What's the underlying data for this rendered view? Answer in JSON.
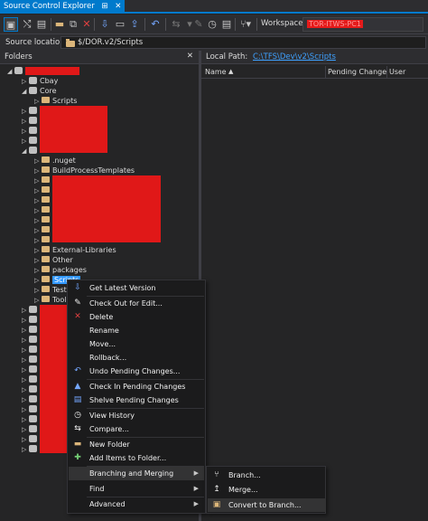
{
  "window": {
    "tab_title": "Source Control Explorer",
    "close_glyph": "✕",
    "pin_glyph": "⊞"
  },
  "toolbar": {
    "workspace_label": "Workspace:",
    "workspace_value": "TOR-ITWS-PC1"
  },
  "source_location": {
    "label": "Source location:",
    "value": "$/DOR.v2/Scripts"
  },
  "folders_pane": {
    "title": "Folders",
    "close_glyph": "✕"
  },
  "details_pane": {
    "local_path_label": "Local Path:",
    "local_path_value": "C:\\TFS\\Dev\\v2\\Scripts",
    "columns": [
      "Name",
      "Pending Change",
      "User"
    ],
    "sort_glyph": "▲"
  },
  "tree": {
    "items": [
      {
        "label": "Cbay",
        "kind": "folder"
      },
      {
        "label": "Core",
        "kind": "folder"
      },
      {
        "label": "Scripts",
        "kind": "folder"
      },
      {
        "label": ".nuget",
        "kind": "folder"
      },
      {
        "label": "BuildProcessTemplates",
        "kind": "folder"
      },
      {
        "label": "External-Libraries",
        "kind": "folder"
      },
      {
        "label": "Other",
        "kind": "folder"
      },
      {
        "label": "packages",
        "kind": "folder"
      },
      {
        "label": "Scripts",
        "kind": "folder"
      },
      {
        "label": "Test",
        "kind": "folder"
      },
      {
        "label": "Tool",
        "kind": "folder"
      }
    ]
  },
  "context_menu": {
    "items": [
      {
        "label": "Get Latest Version",
        "icon": "get-latest-icon",
        "glyph": "⇩"
      },
      {
        "label": "Check Out for Edit...",
        "icon": "check-out-icon",
        "glyph": "✎"
      },
      {
        "label": "Delete",
        "icon": "delete-icon",
        "glyph": "✕"
      },
      {
        "label": "Rename",
        "icon": "",
        "glyph": ""
      },
      {
        "label": "Move...",
        "icon": "",
        "glyph": ""
      },
      {
        "label": "Rollback...",
        "icon": "",
        "glyph": ""
      },
      {
        "label": "Undo Pending Changes...",
        "icon": "undo-icon",
        "glyph": "↶"
      },
      {
        "label": "Check In Pending Changes",
        "icon": "check-in-icon",
        "glyph": "▲"
      },
      {
        "label": "Shelve Pending Changes",
        "icon": "shelve-icon",
        "glyph": "▤"
      },
      {
        "label": "View History",
        "icon": "history-icon",
        "glyph": "◷"
      },
      {
        "label": "Compare...",
        "icon": "compare-icon",
        "glyph": "⇆"
      },
      {
        "label": "New Folder",
        "icon": "new-folder-icon",
        "glyph": "▬"
      },
      {
        "label": "Add Items to Folder...",
        "icon": "add-items-icon",
        "glyph": "✚"
      },
      {
        "label": "Branching and Merging",
        "icon": "",
        "glyph": "",
        "submenu": true
      },
      {
        "label": "Find",
        "icon": "",
        "glyph": "",
        "submenu": true
      },
      {
        "label": "Advanced",
        "icon": "",
        "glyph": "",
        "submenu": true
      }
    ],
    "submenu_glyph": "▶"
  },
  "branch_submenu": {
    "items": [
      {
        "label": "Branch...",
        "icon": "branch-icon",
        "glyph": "⑂"
      },
      {
        "label": "Merge...",
        "icon": "merge-icon",
        "glyph": "↥"
      },
      {
        "label": "Convert to Branch...",
        "icon": "convert-branch-icon",
        "glyph": "▣"
      }
    ]
  },
  "colors": {
    "accent": "#007acc",
    "background": "#252526",
    "menu_bg": "#1b1b1c",
    "selection": "#3399ff",
    "redaction": "#e01818",
    "folder": "#dcb67a"
  }
}
